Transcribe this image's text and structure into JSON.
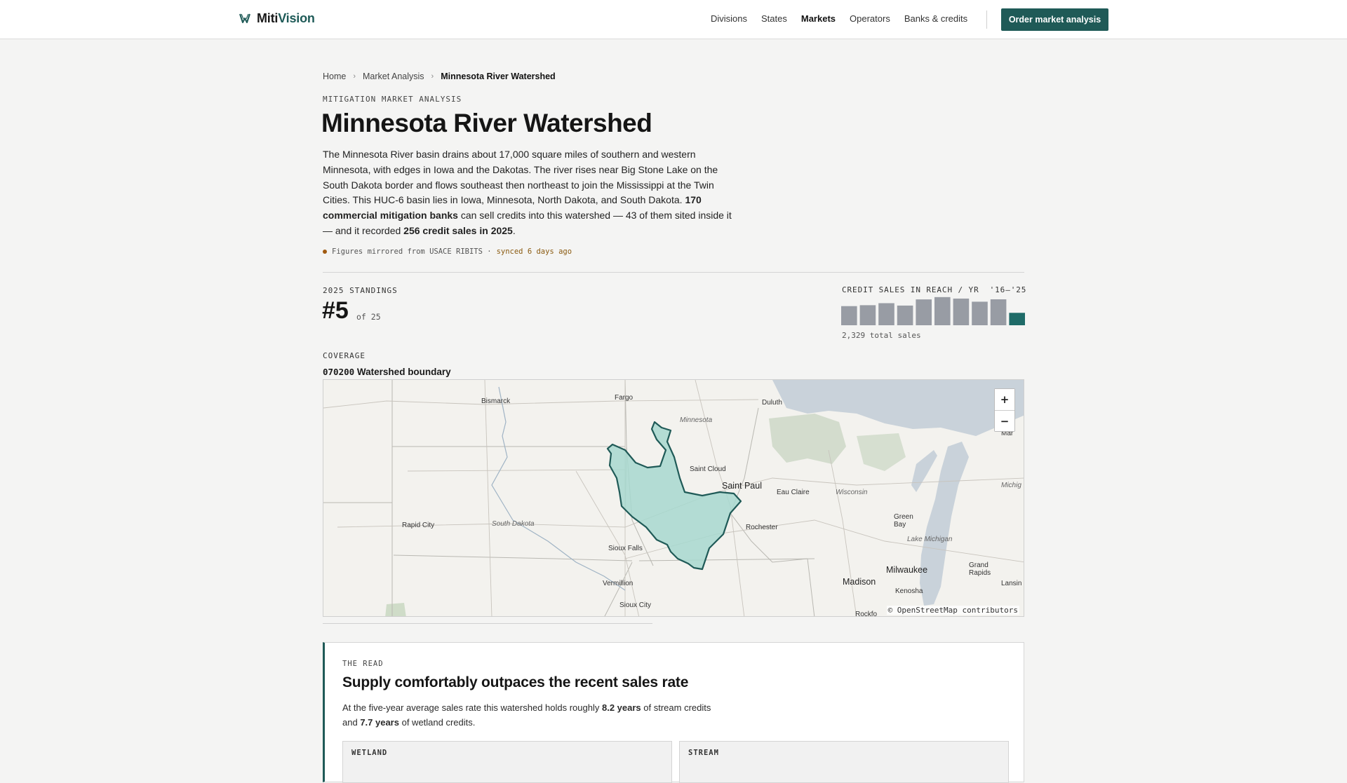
{
  "header": {
    "brand_part1": "Miti",
    "brand_part2": "Vision",
    "nav": [
      "Divisions",
      "States",
      "Markets",
      "Operators",
      "Banks & credits"
    ],
    "nav_active": "Markets",
    "cta_label": "Order market analysis"
  },
  "breadcrumb": [
    "Home",
    "Market Analysis",
    "Minnesota River Watershed"
  ],
  "hero": {
    "eyebrow": "MITIGATION MARKET ANALYSIS",
    "title": "Minnesota River Watershed",
    "intro_1": "The Minnesota River basin drains about 17,000 square miles of southern and western Minnesota, with edges in Iowa and the Dakotas. The river rises near Big Stone Lake on the South Dakota border and flows southeast then northeast to join the Mississippi at the Twin Cities. This HUC-6 basin lies in Iowa, Minnesota, North Dakota, and South Dakota. ",
    "intro_bold_1": "170 commercial mitigation banks",
    "intro_2": " can sell credits into this watershed — 43 of them sited inside it — and it recorded ",
    "intro_bold_2": "256 credit sales in 2025",
    "intro_3": ".",
    "sync_text": "Figures mirrored from USACE RIBITS ·",
    "sync_age": "synced 6 days ago"
  },
  "standings": {
    "label": "2025 STANDINGS",
    "rank": "#5",
    "of": "of 25"
  },
  "sales": {
    "label": "CREDIT SALES IN REACH / YR",
    "range": "'16–'25",
    "total": "2,329 total sales",
    "bar_color": "#989ca4",
    "highlight_color": "#1f6b68"
  },
  "chart_data": {
    "type": "bar",
    "categories": [
      "2016",
      "2017",
      "2018",
      "2019",
      "2020",
      "2021",
      "2022",
      "2023",
      "2024",
      "2025"
    ],
    "values": [
      208,
      218,
      240,
      214,
      281,
      306,
      290,
      256,
      282,
      135
    ],
    "title": "CREDIT SALES IN REACH / YR",
    "xlabel": "",
    "ylabel": "",
    "ylim": [
      0,
      320
    ]
  },
  "coverage": {
    "label": "COVERAGE",
    "code": "070200",
    "boundary": "Watershed boundary"
  },
  "map": {
    "attribution": "© OpenStreetMap contributors",
    "zoom_in": "+",
    "zoom_out": "−",
    "water_color": "#c9d2da",
    "watershed_fill": "#a7d8cf",
    "watershed_stroke": "#1f5a57",
    "places": {
      "bismarck": "Bismarck",
      "fargo": "Fargo",
      "duluth": "Duluth",
      "minnesota": "Minnesota",
      "saint_cloud": "Saint Cloud",
      "saint_paul": "Saint Paul",
      "eau_claire": "Eau Claire",
      "wisconsin": "Wisconsin",
      "green_bay": "Green Bay",
      "rapid_city": "Rapid City",
      "south_dakota": "South Dakota",
      "rochester": "Rochester",
      "sioux_falls": "Sioux Falls",
      "lake_michigan": "Lake Michigan",
      "milwaukee": "Milwaukee",
      "grand_rapids": "Grand Rapids",
      "madison": "Madison",
      "kenosha": "Kenosha",
      "vermillion": "Vermillion",
      "sioux_city": "Sioux City",
      "michigan": "Michig",
      "lansing": "Lansin",
      "rockford": "Rockfo",
      "ult_mar": "ult Mar"
    }
  },
  "read": {
    "eyebrow": "THE READ",
    "title": "Supply comfortably outpaces the recent sales rate",
    "body_1": "At the five-year average sales rate this watershed holds roughly ",
    "body_bold_1": "8.2 years",
    "body_2": " of stream credits and ",
    "body_bold_2": "7.7 years",
    "body_3": " of wetland credits.",
    "panel_wetland": "WETLAND",
    "panel_stream": "STREAM"
  }
}
